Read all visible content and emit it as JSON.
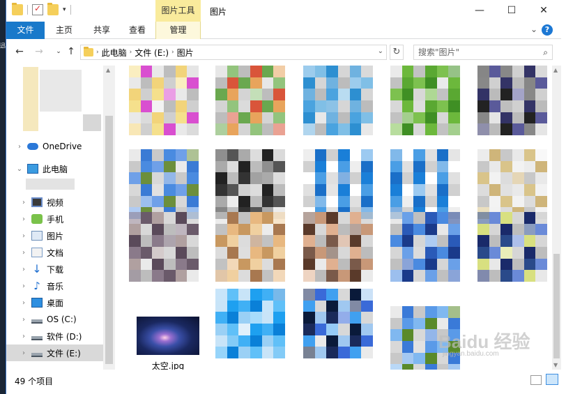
{
  "titlebar": {
    "context_tab": "图片工具",
    "title": "图片",
    "minimize": "—",
    "maximize": "☐",
    "close": "✕"
  },
  "ribbon": {
    "tabs": [
      "文件",
      "主页",
      "共享",
      "查看",
      "管理"
    ],
    "expand": "⌄",
    "help": "?"
  },
  "address": {
    "crumbs": [
      "此电脑",
      "文件 (E:)",
      "图片"
    ],
    "search_placeholder": "搜索\"图片\""
  },
  "nav": {
    "items": [
      {
        "label": "OneDrive",
        "icon": "onedrive-icon",
        "chev": "›"
      },
      {
        "label": "此电脑",
        "icon": "computer-icon",
        "chev": "⌄"
      },
      {
        "label": "视频",
        "icon": "video-icon",
        "chev": "›"
      },
      {
        "label": "手机",
        "icon": "phone-icon",
        "chev": "›"
      },
      {
        "label": "图片",
        "icon": "pictures-icon",
        "chev": "›"
      },
      {
        "label": "文档",
        "icon": "documents-icon",
        "chev": "›"
      },
      {
        "label": "下载",
        "icon": "download-icon",
        "chev": "›"
      },
      {
        "label": "音乐",
        "icon": "music-icon",
        "chev": "›"
      },
      {
        "label": "桌面",
        "icon": "desktop-icon",
        "chev": "›"
      },
      {
        "label": "OS (C:)",
        "icon": "drive-icon",
        "chev": "›"
      },
      {
        "label": "软件 (D:)",
        "icon": "drive-icon",
        "chev": "›"
      },
      {
        "label": "文件 (E:)",
        "icon": "drive-icon",
        "chev": "›"
      }
    ]
  },
  "content": {
    "named_file": "太空.jpg"
  },
  "status": {
    "item_count": "49 个项目"
  },
  "watermark": {
    "brand": "Baidu 经验",
    "url": "jingyan.baidu.com"
  }
}
